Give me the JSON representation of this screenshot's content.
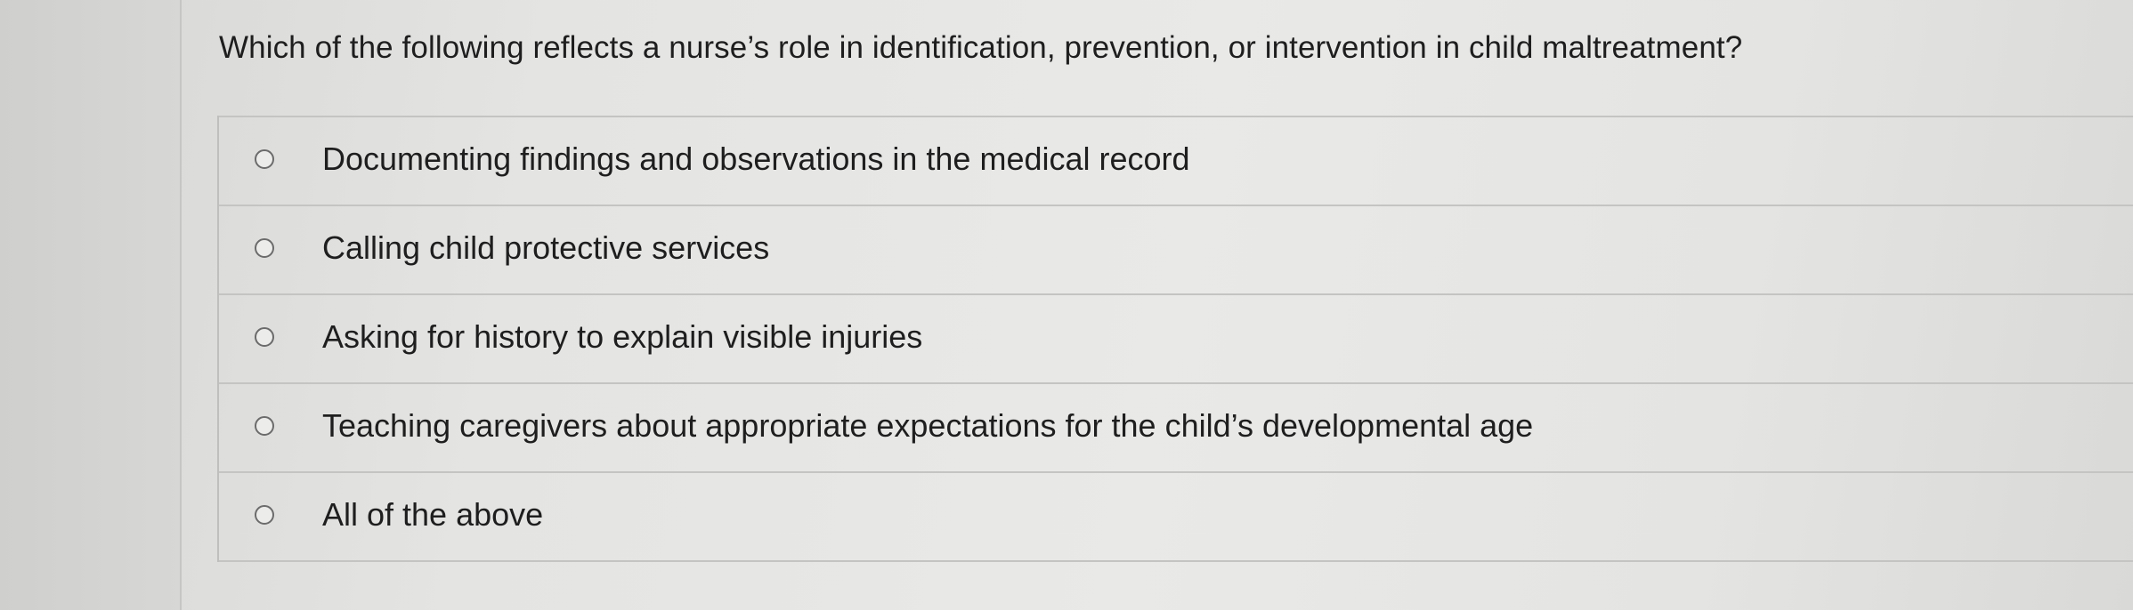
{
  "question": {
    "text": "Which of the following reflects a nurse’s role in identification, prevention, or intervention in child maltreatment?"
  },
  "options": [
    {
      "label": "Documenting findings and observations in the medical record",
      "selected": false
    },
    {
      "label": "Calling child protective services",
      "selected": false
    },
    {
      "label": "Asking for history to explain visible injuries",
      "selected": false
    },
    {
      "label": "Teaching caregivers about appropriate expectations for the child’s developmental age",
      "selected": false
    },
    {
      "label": "All of the above",
      "selected": false
    }
  ],
  "colors": {
    "text": "#1e1e1e",
    "radio_border": "#6b6b6b",
    "divider": "#c4c4c2",
    "background": "#e6e6e4"
  }
}
